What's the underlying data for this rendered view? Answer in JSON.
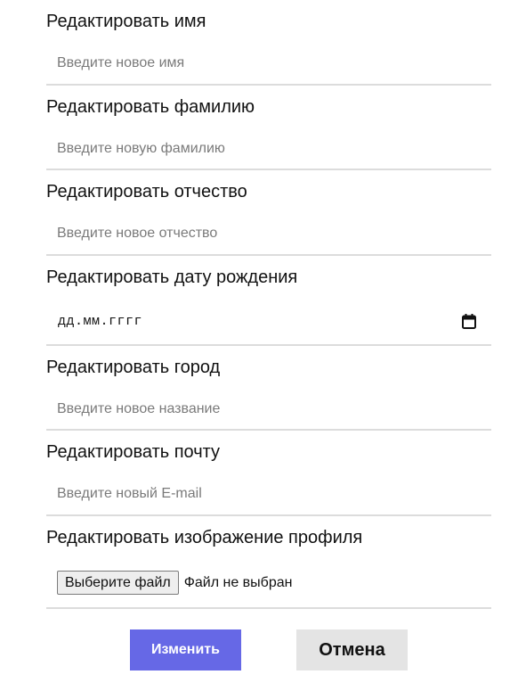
{
  "fields": [
    {
      "label": "Редактировать имя",
      "placeholder": "Введите новое имя"
    },
    {
      "label": "Редактировать фамилию",
      "placeholder": "Введите новую фамилию"
    },
    {
      "label": "Редактировать отчество",
      "placeholder": "Введите новое отчество"
    },
    {
      "label": "Редактировать дату рождения",
      "placeholder": "дд.мм.гггг",
      "icon": "calendar-icon"
    },
    {
      "label": "Редактировать город",
      "placeholder": "Введите новое название"
    },
    {
      "label": "Редактировать почту",
      "placeholder": "Введите новый E-mail"
    },
    {
      "label": "Редактировать изображение профиля",
      "button_label": "Выберите файл",
      "status": "Файл не выбран"
    }
  ],
  "actions": {
    "submit_label": "Изменить",
    "cancel_label": "Отмена"
  },
  "colors": {
    "primary_button": "#6668e6",
    "secondary_button": "#e4e4e4",
    "divider": "#dcdcdc",
    "placeholder_text": "#7a7a7a"
  }
}
